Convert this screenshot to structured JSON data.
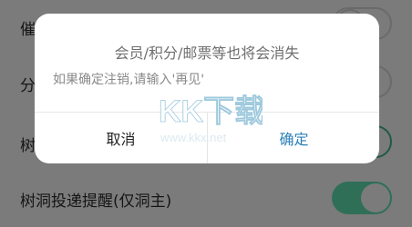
{
  "settings": {
    "rows": [
      {
        "label": "催",
        "toggle": "off"
      },
      {
        "label": "分",
        "toggle": "off"
      },
      {
        "label": "树",
        "toggle": "on"
      },
      {
        "label": "树洞投递提醒(仅洞主)",
        "toggle": "on"
      }
    ]
  },
  "dialog": {
    "header": "会员/积分/邮票等也将会消失",
    "message": "如果确定注销,请输入'再见'",
    "cancel_label": "取消",
    "confirm_label": "确定"
  },
  "watermark": {
    "brand": "KK下载",
    "url": "www.kkx.net"
  },
  "colors": {
    "toggle_on": "#2f6f58",
    "confirm_text": "#2b7fb8",
    "dim_overlay": "#7b7b7b"
  }
}
